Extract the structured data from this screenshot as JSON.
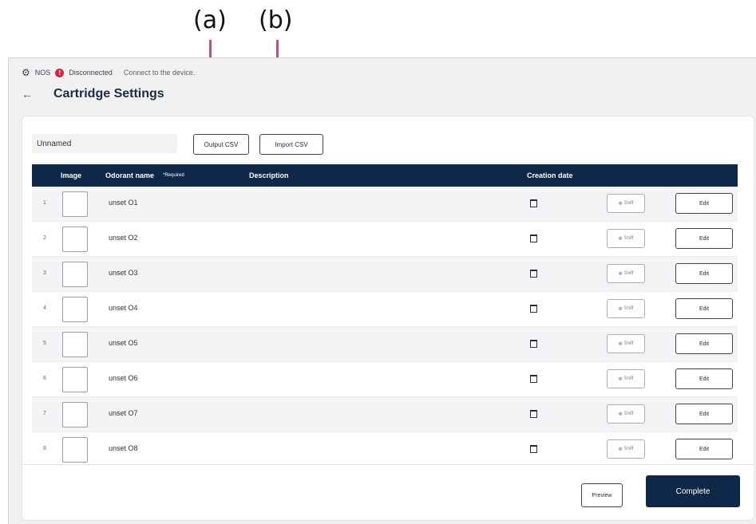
{
  "annotations": {
    "a": "(a)",
    "b": "(b)"
  },
  "status_bar": {
    "device": "NOS",
    "status": "Disconnected",
    "message": "Connect to the device."
  },
  "header": {
    "title": "Cartridge Settings"
  },
  "toolbar": {
    "name_value": "Unnamed",
    "output_csv": "Output CSV",
    "import_csv": "Import CSV"
  },
  "table": {
    "columns": {
      "image": "Image",
      "odorant_name": "Odorant name",
      "required": "*Required",
      "description": "Description",
      "creation_date": "Creation date"
    },
    "sniff_label": "Sniff",
    "edit_label": "Edit",
    "rows": [
      {
        "index": "1",
        "name": "unset O1"
      },
      {
        "index": "2",
        "name": "unset O2"
      },
      {
        "index": "3",
        "name": "unset O3"
      },
      {
        "index": "4",
        "name": "unset O4"
      },
      {
        "index": "5",
        "name": "unset O5"
      },
      {
        "index": "6",
        "name": "unset O6"
      },
      {
        "index": "7",
        "name": "unset O7"
      },
      {
        "index": "8",
        "name": "unset O8"
      }
    ]
  },
  "footer": {
    "preview": "Preview",
    "complete": "Complete"
  },
  "colors": {
    "navy": "#0f2748",
    "annotation": "#b0587e",
    "error": "#d7263d"
  }
}
